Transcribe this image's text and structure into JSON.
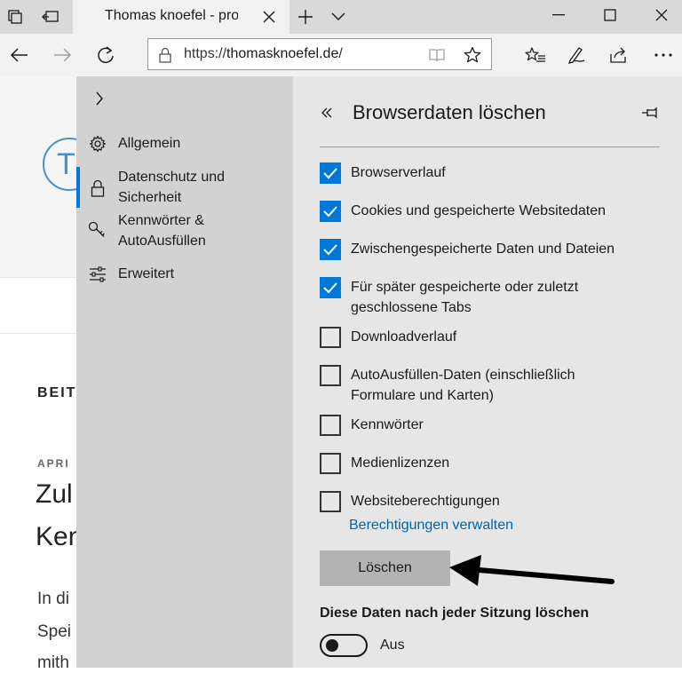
{
  "browser": {
    "tab_title": "Thomas knoefel - profes",
    "url_prefix": "https://",
    "url_host": "thomasknoefel.de",
    "url_suffix": "/"
  },
  "page_bg": {
    "logo_letter": "T",
    "heading_fragment": "BEIT",
    "date_fragment": "APRI",
    "title_line1": "Zul",
    "title_line2": "Ken",
    "body_line1": "In di",
    "body_line2": "Spei",
    "body_line3": "mith"
  },
  "settings_menu": {
    "items": [
      {
        "label": "Allgemein",
        "icon": "gear-icon"
      },
      {
        "label_line1": "Datenschutz und",
        "label_line2": "Sicherheit",
        "icon": "lock-icon",
        "active": true
      },
      {
        "label_line1": "Kennwörter &",
        "label_line2": "AutoAusfüllen",
        "icon": "key-icon"
      },
      {
        "label": "Erweitert",
        "icon": "sliders-icon"
      }
    ]
  },
  "clear_panel": {
    "title": "Browserdaten löschen",
    "options": [
      {
        "label": "Browserverlauf",
        "checked": true
      },
      {
        "label": "Cookies und gespeicherte Websitedaten",
        "checked": true
      },
      {
        "label": "Zwischengespeicherte Daten und Dateien",
        "checked": true
      },
      {
        "label_line1": "Für später gespeicherte oder zuletzt",
        "label_line2": "geschlossene Tabs",
        "checked": true
      },
      {
        "label": "Downloadverlauf",
        "checked": false
      },
      {
        "label_line1": "AutoAusfüllen-Daten (einschließlich",
        "label_line2": "Formulare und Karten)",
        "checked": false
      },
      {
        "label": "Kennwörter",
        "checked": false
      },
      {
        "label": "Medienlizenzen",
        "checked": false
      },
      {
        "label": "Websiteberechtigungen",
        "checked": false
      }
    ],
    "permissions_link": "Berechtigungen verwalten",
    "delete_button": "Löschen",
    "session_label": "Diese Daten nach jeder Sitzung löschen",
    "session_toggle_state": "Aus"
  },
  "colors": {
    "accent": "#0078d7",
    "link": "#0063b1",
    "left_panel_bg": "#d2d2d2",
    "right_panel_bg": "#e6e6e6"
  }
}
